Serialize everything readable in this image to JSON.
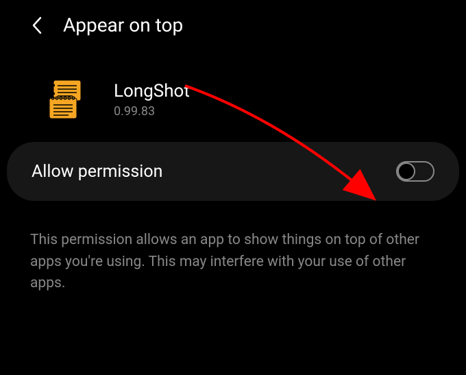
{
  "header": {
    "title": "Appear on top"
  },
  "app": {
    "name": "LongShot",
    "version": "0.99.83"
  },
  "permission": {
    "label": "Allow permission",
    "enabled": false
  },
  "description": "This permission allows an app to show things on top of other apps you're using. This may interfere with your use of other apps."
}
